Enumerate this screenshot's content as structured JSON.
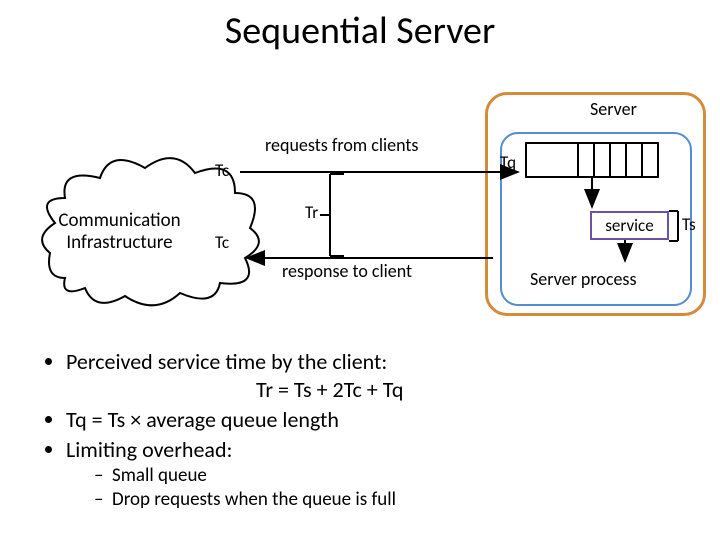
{
  "title": "Sequential Server",
  "diagram": {
    "server_label": "Server",
    "requests_label": "requests from clients",
    "response_label": "response to client",
    "server_process_label": "Server process",
    "service_label": "service",
    "cloud_line1": "Communication",
    "cloud_line2": "Infrastructure",
    "Tc": "Tc",
    "Tr": "Tr",
    "Tq": "Tq",
    "Ts": "Ts"
  },
  "bullets": {
    "b1": "Perceived service time by the client:",
    "eq1": "Tr = Ts + 2Tc + Tq",
    "b2": "Tq = Ts × average queue length",
    "b3": "Limiting overhead:",
    "s1": "Small queue",
    "s2": "Drop requests when the queue is full"
  }
}
